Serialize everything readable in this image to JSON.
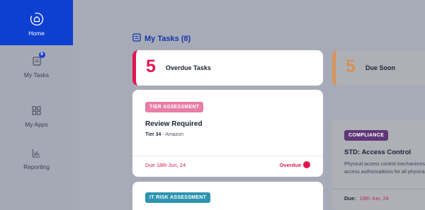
{
  "sidebar": {
    "items": [
      {
        "label": "Home",
        "icon": "home-icon",
        "active": true
      },
      {
        "label": "My Tasks",
        "icon": "tasks-icon",
        "badge": "8"
      },
      {
        "label": "My Apps",
        "icon": "grid-icon"
      },
      {
        "label": "Reporting",
        "icon": "bar-chart-icon"
      }
    ]
  },
  "main": {
    "title": "My Tasks (8)",
    "summary": {
      "overdue": {
        "count": "5",
        "label": "Overdue Tasks"
      },
      "due_soon": {
        "count": "5",
        "label": "Due Soon"
      }
    },
    "tasks": [
      {
        "tag": "TIER ASSESSMENT",
        "title": "Review Required",
        "tier": "Tier 34",
        "vendor": " - Amazon",
        "due": "Due 18th Jun, 24",
        "status": "Overdue"
      },
      {
        "tag": "IT RISK ASSESSMENT"
      }
    ],
    "compliance": {
      "tag": "COMPLIANCE",
      "title": "STD: Access Control",
      "desc_line1": "Physical access control mechanisms",
      "desc_line2": "access authorisaitions for all physica",
      "due_label": "Due:",
      "due_date": "18th Jun, 24"
    }
  },
  "colors": {
    "accent": "#0d3fd0",
    "overdue": "#e01850",
    "due_soon": "#d8955c",
    "tier_tag": "#e87ea5",
    "compliance_tag": "#5e3778",
    "risk_tag": "#2e95b1"
  }
}
